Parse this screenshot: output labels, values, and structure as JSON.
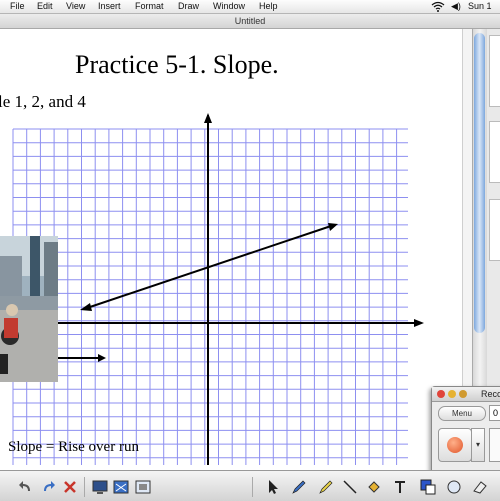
{
  "menubar": {
    "items": [
      "File",
      "Edit",
      "View",
      "Insert",
      "Format",
      "Draw",
      "Window",
      "Help"
    ],
    "clock": "Sun 1"
  },
  "window": {
    "title": "Untitled"
  },
  "document": {
    "title": "Practice 5-1. Slope.",
    "subtitle": "le 1, 2, and 4",
    "footer_note": "Slope = Rise over run"
  },
  "graph": {
    "grid_color": "#8d8ff0",
    "line_color": "#000000"
  },
  "recorder": {
    "title": "Reco",
    "menu_label": "Menu",
    "field_value": "0",
    "record_color": "#e0552a"
  },
  "toolbar": {
    "icons": [
      "undo-icon",
      "redo-icon",
      "delete-icon",
      "display-icon",
      "screen-capture-icon",
      "full-screen-icon",
      "select-icon",
      "pen-icon",
      "highlighter-icon",
      "eraser-icon",
      "line-icon",
      "fill-icon",
      "text-icon",
      "color-icon",
      "shape-icon"
    ]
  }
}
